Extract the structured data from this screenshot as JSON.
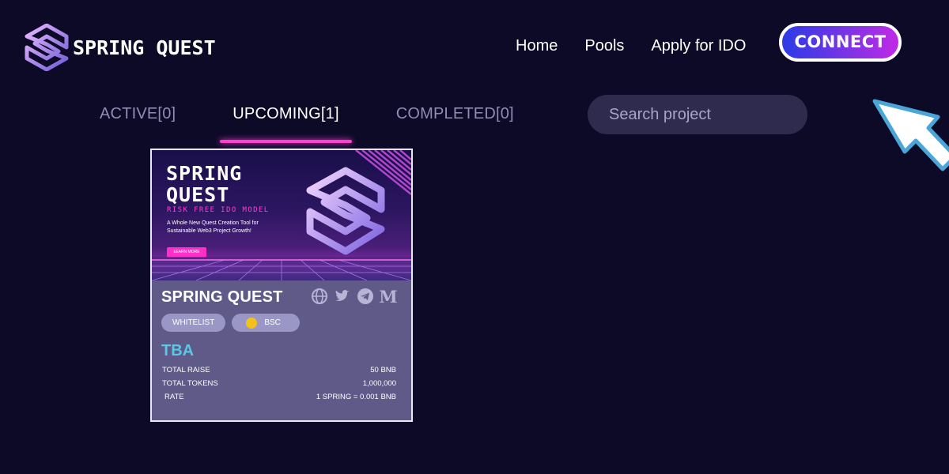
{
  "brand": {
    "name": "SPRING QUEST"
  },
  "nav": {
    "items": [
      "Home",
      "Pools",
      "Apply for IDO"
    ],
    "connect_label": "CONNECT"
  },
  "tabs": [
    {
      "label": "ACTIVE[0]",
      "active": false
    },
    {
      "label": "UPCOMING[1]",
      "active": true
    },
    {
      "label": "COMPLETED[0]",
      "active": false
    }
  ],
  "search": {
    "placeholder": "Search project",
    "icon": "search-icon"
  },
  "colors": {
    "background": "#0c0a26",
    "accent": "#ff3fd0",
    "card": "#5f5a87",
    "tba": "#5bc6e6"
  },
  "project": {
    "banner": {
      "title_line1": "SPRING",
      "title_line2": "QUEST",
      "subtitle": "RISK FREE IDO MODEL",
      "description": "A Whole New Quest Creation Tool for Sustainable Web3 Project Growth!",
      "button": "LEARN MORE"
    },
    "name": "SPRING QUEST",
    "social_icons": [
      "globe-icon",
      "twitter-icon",
      "telegram-icon",
      "medium-icon"
    ],
    "medium_glyph": "M",
    "tags": {
      "whitelist": "WHITELIST",
      "chain": "BSC"
    },
    "status": "TBA",
    "stats": [
      {
        "label": "TOTAL RAISE",
        "value": "50 BNB"
      },
      {
        "label": "TOTAL TOKENS",
        "value": "1,000,000"
      },
      {
        "label": "RATE",
        "value": "1 SPRING = 0.001 BNB"
      }
    ]
  }
}
